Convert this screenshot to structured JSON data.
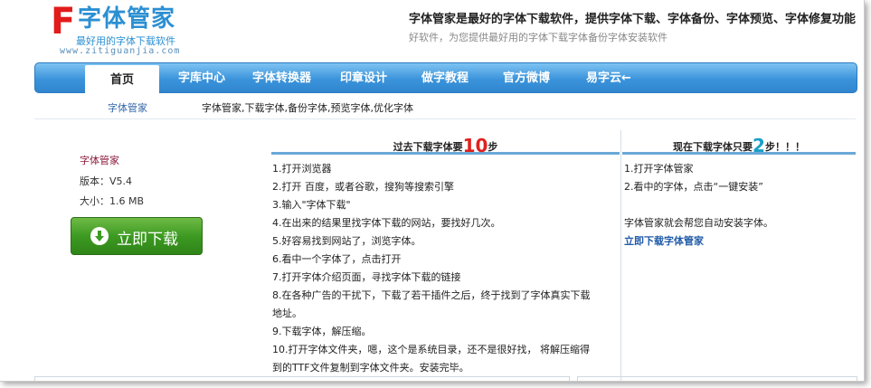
{
  "header": {
    "logo_letter": "F",
    "logo_name": "字体管家",
    "logo_slogan": "最好用的字体下载软件",
    "logo_url": "www.zitiguanjia.com",
    "tagline": "字体管家是最好的字体下载软件，提供字体下载、字体备份、字体预览、字体修复功能",
    "subtagline": "好软件，为您提供最好用的字体下载字体备份字体安装软件"
  },
  "nav": {
    "items": [
      "首页",
      "字库中心",
      "字体转换器",
      "印章设计",
      "做字教程",
      "官方微博",
      "易字云←"
    ]
  },
  "subnav": {
    "left": "字体管家",
    "right": "字体管家,下载字体,备份字体,预览字体,优化字体"
  },
  "product": {
    "name": "字体管家",
    "version": "版本：V5.4",
    "size": "大小：1.6 MB",
    "download_label": "立即下载"
  },
  "past": {
    "title_prefix": "过去下载字体要",
    "title_num": "10",
    "title_suffix": "步",
    "steps": [
      "1.打开浏览器",
      "2.打开 百度，或者谷歌，搜狗等搜索引擎",
      "3.输入\"字体下载\"",
      "4.在出来的结果里找字体下载的网站，要找好几次。",
      "5.好容易找到网站了，浏览字体。",
      "6.看中一个字体了，点击打开",
      "7.打开字体介绍页面，寻找字体下载的链接",
      "8.在各种广告的干扰下，下载了若干插件之后，终于找到了字体真实下载",
      "地址。",
      "9.下载字体，解压缩。",
      "10.打开字体文件夹，嗯，这个是系统目录，还不是很好找， 将解压缩得",
      "到的TTF文件复制到字体文件夹。安装完毕。"
    ]
  },
  "now": {
    "title_prefix": "现在下载字体只要",
    "title_num": "2",
    "title_suffix": "步！！！",
    "steps": [
      "1.打开字体管家",
      "2.看中的字体，点击“一键安装”"
    ],
    "note": "字体管家就会帮您自动安装字体。",
    "link": "立即下载字体管家"
  }
}
